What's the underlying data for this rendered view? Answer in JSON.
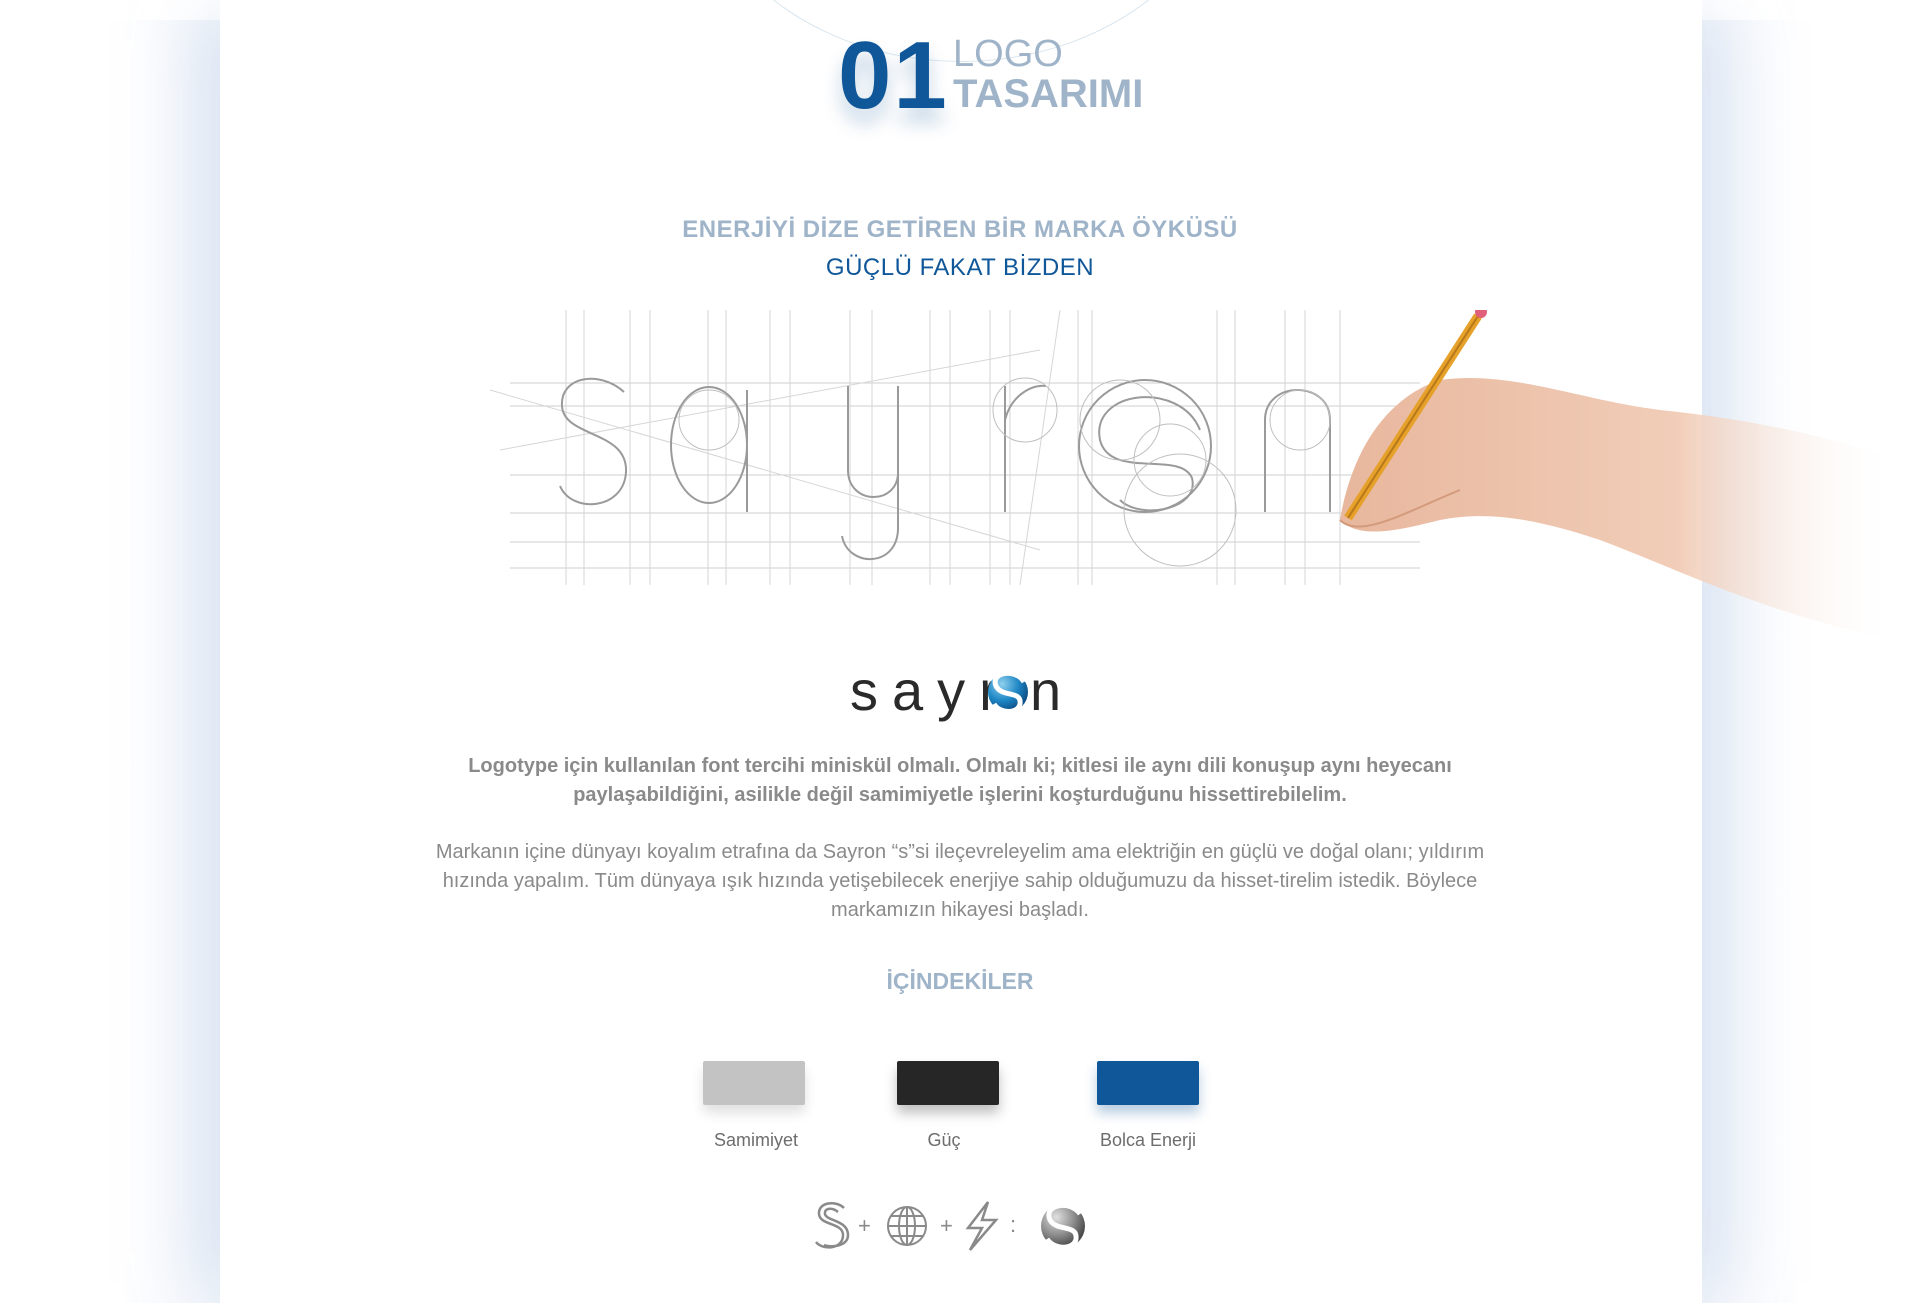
{
  "header": {
    "number": "01",
    "line1": "LOGO",
    "line2": "TASARIMI"
  },
  "tagline": {
    "line1": "ENERJİYİ DİZE GETİREN BİR MARKA ÖYKÜSÜ",
    "line2": "GÜÇLÜ FAKAT BİZDEN"
  },
  "sketch": {
    "letters": "sayron",
    "description_icon": "hand-with-pencil-icon"
  },
  "brand": {
    "prefix": "sayr",
    "suffix": "n",
    "logo_icon": "sayron-globe-s-icon"
  },
  "paragraphs": {
    "bold": "Logotype için kullanılan font tercihi miniskül olmalı. Olmalı ki; kitlesi ile aynı dili konuşup aynı heyecanı paylaşabildiğini, asilikle değil samimiyetle işlerini koşturduğunu hissettirebilelim.",
    "regular": "Markanın içine dünyayı koyalım etrafına da Sayron “s”si ileçevreleyelim ama elektriğin en güçlü ve doğal olanı; yıldırım hızında yapalım. Tüm dünyaya ışık hızında yetişebilecek enerjiye sahip olduğumuzu da hisset-tirelim istedik. Böylece markamızın hikayesi başladı."
  },
  "contents": {
    "title": "İÇİNDEKİLER",
    "colors": [
      {
        "label": "Samimiyet",
        "color": "#c3c3c3"
      },
      {
        "label": "Güç",
        "color": "#262626"
      },
      {
        "label": "Bolca Enerji",
        "color": "#0f5799"
      }
    ]
  },
  "formula": {
    "icons": [
      "letter-s-icon",
      "plus-icon",
      "globe-icon",
      "plus-icon",
      "lightning-icon",
      "equals-icon",
      "sayron-globe-s-icon"
    ],
    "plus": "+",
    "equals": ":"
  }
}
